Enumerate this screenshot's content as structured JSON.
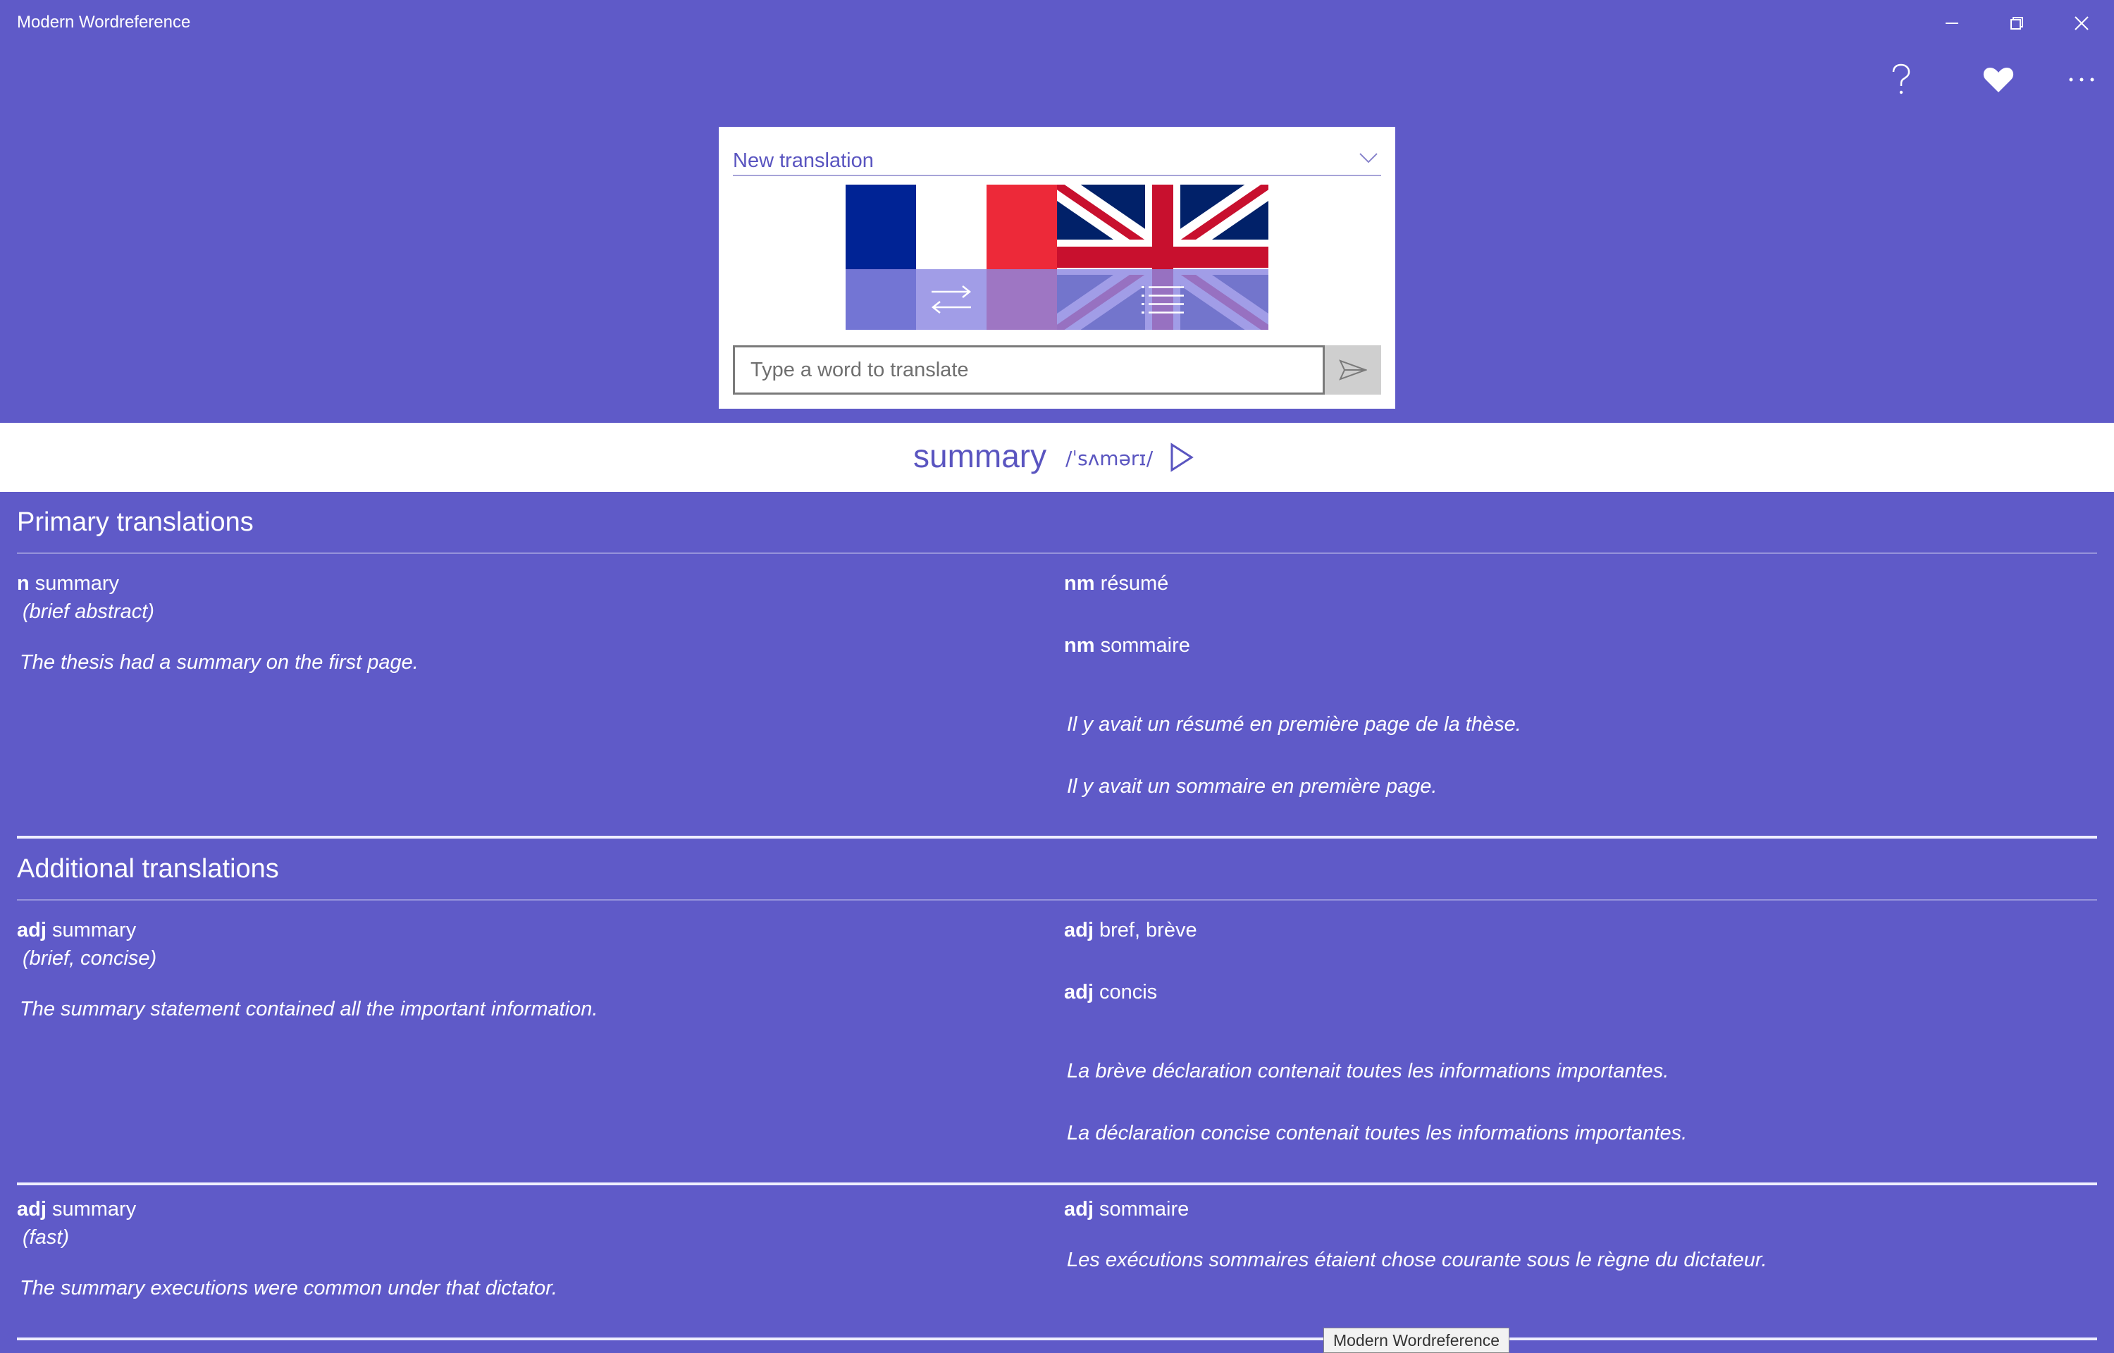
{
  "window": {
    "title": "Modern Wordreference",
    "minimize_icon": "minimize-icon",
    "maximize_icon": "restore-icon",
    "close_icon": "close-icon"
  },
  "toolbar": {
    "help_icon": "question-mark-icon",
    "favorites_icon": "heart-icon",
    "more_icon": "more-ellipsis-icon"
  },
  "translator": {
    "mode_selected": "New translation",
    "from_language_flag": "france-flag",
    "to_language_flag": "uk-flag",
    "swap_icon": "swap-arrows-icon",
    "list_icon": "list-icon",
    "search_placeholder": "Type a word to translate",
    "search_value": "",
    "send_icon": "send-icon"
  },
  "headword": {
    "word": "summary",
    "pronunciation": "/ˈsʌmərɪ/",
    "play_icon": "play-icon"
  },
  "sections": {
    "primary": {
      "title": "Primary translations",
      "entries": [
        {
          "source_pos": "n",
          "source_word": "summary",
          "note": "(brief abstract)",
          "source_example": "The thesis had a summary on the first page.",
          "targets": [
            {
              "pos": "nm",
              "word": "résumé"
            },
            {
              "pos": "nm",
              "word": "sommaire"
            }
          ],
          "target_examples": [
            "Il y avait un résumé en première page de la thèse.",
            "Il y avait un sommaire en première page."
          ]
        }
      ]
    },
    "additional": {
      "title": "Additional translations",
      "entries": [
        {
          "source_pos": "adj",
          "source_word": "summary",
          "note": "(brief, concise)",
          "source_example": "The summary statement contained all the important information.",
          "targets": [
            {
              "pos": "adj",
              "word": "bref, brève"
            },
            {
              "pos": "adj",
              "word": "concis"
            }
          ],
          "target_examples": [
            "La brève déclaration contenait toutes les informations importantes.",
            "La déclaration concise contenait toutes les informations importantes."
          ]
        },
        {
          "source_pos": "adj",
          "source_word": "summary",
          "note": "(fast)",
          "source_example": "The summary executions were common under that dictator.",
          "targets": [
            {
              "pos": "adj",
              "word": "sommaire"
            }
          ],
          "target_examples": [
            "Les exécutions sommaires étaient chose courante sous le règne du dictateur."
          ]
        }
      ]
    }
  },
  "tooltip": {
    "text": "Modern Wordreference"
  },
  "colors": {
    "background": "#5f5ac8",
    "card": "#ffffff",
    "accent_text": "#5a55c0",
    "send_button": "#cfcfcf"
  }
}
